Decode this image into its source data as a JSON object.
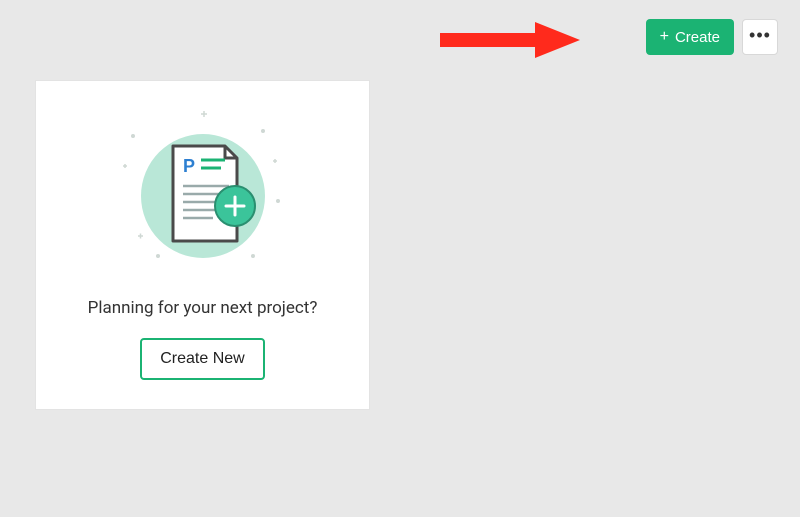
{
  "header": {
    "create_label": "Create",
    "plus_glyph": "+",
    "more_glyph": "•••"
  },
  "card": {
    "prompt": "Planning for your next project?",
    "create_new_label": "Create New",
    "doc_letter": "P"
  },
  "annotation": {
    "arrow_color": "#ff2a1c"
  },
  "colors": {
    "accent_green": "#1bb373",
    "mint_bg": "#b9e7d7",
    "badge_green": "#3bc49a",
    "doc_stroke": "#4a4a4a",
    "page_bg": "#e8e8e8"
  }
}
